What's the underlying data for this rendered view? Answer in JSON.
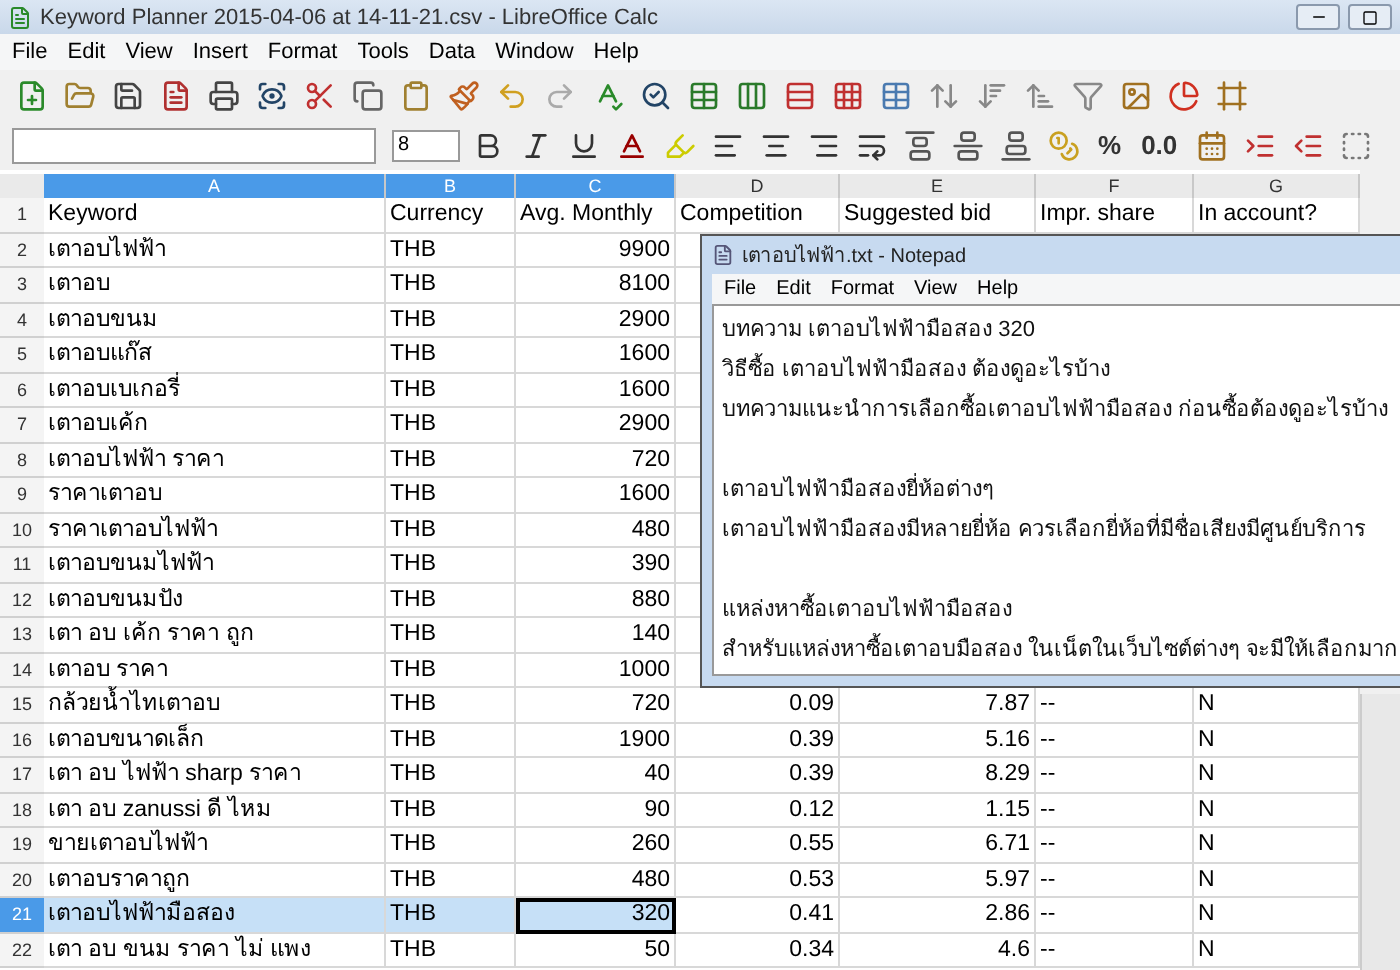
{
  "window": {
    "title": "Keyword Planner 2015-04-06 at 14-11-21.csv - LibreOffice Calc"
  },
  "menu": [
    "File",
    "Edit",
    "View",
    "Insert",
    "Format",
    "Tools",
    "Data",
    "Window",
    "Help"
  ],
  "format_bar": {
    "font_size": "8",
    "number_buttons": [
      "%",
      "0.0"
    ]
  },
  "table": {
    "columns": [
      {
        "letter": "A",
        "selected": true,
        "active": false
      },
      {
        "letter": "B",
        "selected": true,
        "active": false
      },
      {
        "letter": "C",
        "selected": true,
        "active": true
      },
      {
        "letter": "D",
        "selected": false,
        "active": false
      },
      {
        "letter": "E",
        "selected": false,
        "active": false
      },
      {
        "letter": "F",
        "selected": false,
        "active": false
      },
      {
        "letter": "G",
        "selected": false,
        "active": false
      }
    ],
    "rows": [
      {
        "number": "1",
        "selected": false,
        "cells": [
          "Keyword",
          "Currency",
          "Avg. Monthly",
          "Competition",
          "Suggested bid",
          "Impr. share",
          "In account?"
        ]
      },
      {
        "number": "2",
        "selected": false,
        "cells": [
          "เตาอบไฟฟ้า",
          "THB",
          "9900"
        ]
      },
      {
        "number": "3",
        "selected": false,
        "cells": [
          "เตาอบ",
          "THB",
          "8100"
        ]
      },
      {
        "number": "4",
        "selected": false,
        "cells": [
          "เตาอบขนม",
          "THB",
          "2900"
        ]
      },
      {
        "number": "5",
        "selected": false,
        "cells": [
          "เตาอบแก๊ส",
          "THB",
          "1600"
        ]
      },
      {
        "number": "6",
        "selected": false,
        "cells": [
          "เตาอบเบเกอรี่",
          "THB",
          "1600"
        ]
      },
      {
        "number": "7",
        "selected": false,
        "cells": [
          "เตาอบเค้ก",
          "THB",
          "2900"
        ]
      },
      {
        "number": "8",
        "selected": false,
        "cells": [
          "เตาอบไฟฟ้า ราคา",
          "THB",
          "720"
        ]
      },
      {
        "number": "9",
        "selected": false,
        "cells": [
          "ราคาเตาอบ",
          "THB",
          "1600"
        ]
      },
      {
        "number": "10",
        "selected": false,
        "cells": [
          "ราคาเตาอบไฟฟ้า",
          "THB",
          "480"
        ]
      },
      {
        "number": "11",
        "selected": false,
        "cells": [
          "เตาอบขนมไฟฟ้า",
          "THB",
          "390"
        ]
      },
      {
        "number": "12",
        "selected": false,
        "cells": [
          "เตาอบขนมปัง",
          "THB",
          "880"
        ]
      },
      {
        "number": "13",
        "selected": false,
        "cells": [
          "เตา อบ เค้ก ราคา ถูก",
          "THB",
          "140"
        ]
      },
      {
        "number": "14",
        "selected": false,
        "cells": [
          "เตาอบ ราคา",
          "THB",
          "1000"
        ]
      },
      {
        "number": "15",
        "selected": false,
        "cells": [
          "กล้วยน้ำไทเตาอบ",
          "THB",
          "720",
          "0.09",
          "7.87",
          "--",
          "N"
        ]
      },
      {
        "number": "16",
        "selected": false,
        "cells": [
          "เตาอบขนาดเล็ก",
          "THB",
          "1900",
          "0.39",
          "5.16",
          "--",
          "N"
        ]
      },
      {
        "number": "17",
        "selected": false,
        "cells": [
          "เตา อบ ไฟฟ้า sharp ราคา",
          "THB",
          "40",
          "0.39",
          "8.29",
          "--",
          "N"
        ]
      },
      {
        "number": "18",
        "selected": false,
        "cells": [
          "เตา อบ zanussi ดี ไหม",
          "THB",
          "90",
          "0.12",
          "1.15",
          "--",
          "N"
        ]
      },
      {
        "number": "19",
        "selected": false,
        "cells": [
          "ขายเตาอบไฟฟ้า",
          "THB",
          "260",
          "0.55",
          "6.71",
          "--",
          "N"
        ]
      },
      {
        "number": "20",
        "selected": false,
        "cells": [
          "เตาอบราคาถูก",
          "THB",
          "480",
          "0.53",
          "5.97",
          "--",
          "N"
        ]
      },
      {
        "number": "21",
        "selected": true,
        "cells": [
          "เตาอบไฟฟ้ามือสอง",
          "THB",
          "320",
          "0.41",
          "2.86",
          "--",
          "N"
        ]
      },
      {
        "number": "22",
        "selected": false,
        "cells": [
          "เตา อบ ขนม ราคา ไม่ แพง",
          "THB",
          "50",
          "0.34",
          "4.6",
          "--",
          "N"
        ]
      }
    ]
  },
  "notepad": {
    "title": "เตาอบไฟฟ้า.txt - Notepad",
    "menu": [
      "File",
      "Edit",
      "Format",
      "View",
      "Help"
    ],
    "paragraphs": [
      [
        "บทความ เตาอบไฟฟ้ามือสอง 320",
        "วิธีซื้อ เตาอบไฟฟ้ามือสอง ต้องดูอะไรบ้าง",
        "บทความแนะนำการเลือกซื้อเตาอบไฟฟ้ามือสอง ก่อนซื้อต้องดูอะไรบ้าง"
      ],
      [
        "เตาอบไฟฟ้ามือสองยี่ห้อต่างๆ",
        "เตาอบไฟฟ้ามือสองมีหลายยี่ห้อ ควรเลือกยี่ห้อที่มีชื่อเสียงมีศูนย์บริการ"
      ],
      [
        "แหล่งหาซื้อเตาอบไฟฟ้ามือสอง",
        "สำหรับแหล่งหาซื้อเตาอบมือสอง ในเน็ตในเว็บไซต์ต่างๆ จะมีให้เลือกมาก"
      ]
    ]
  }
}
